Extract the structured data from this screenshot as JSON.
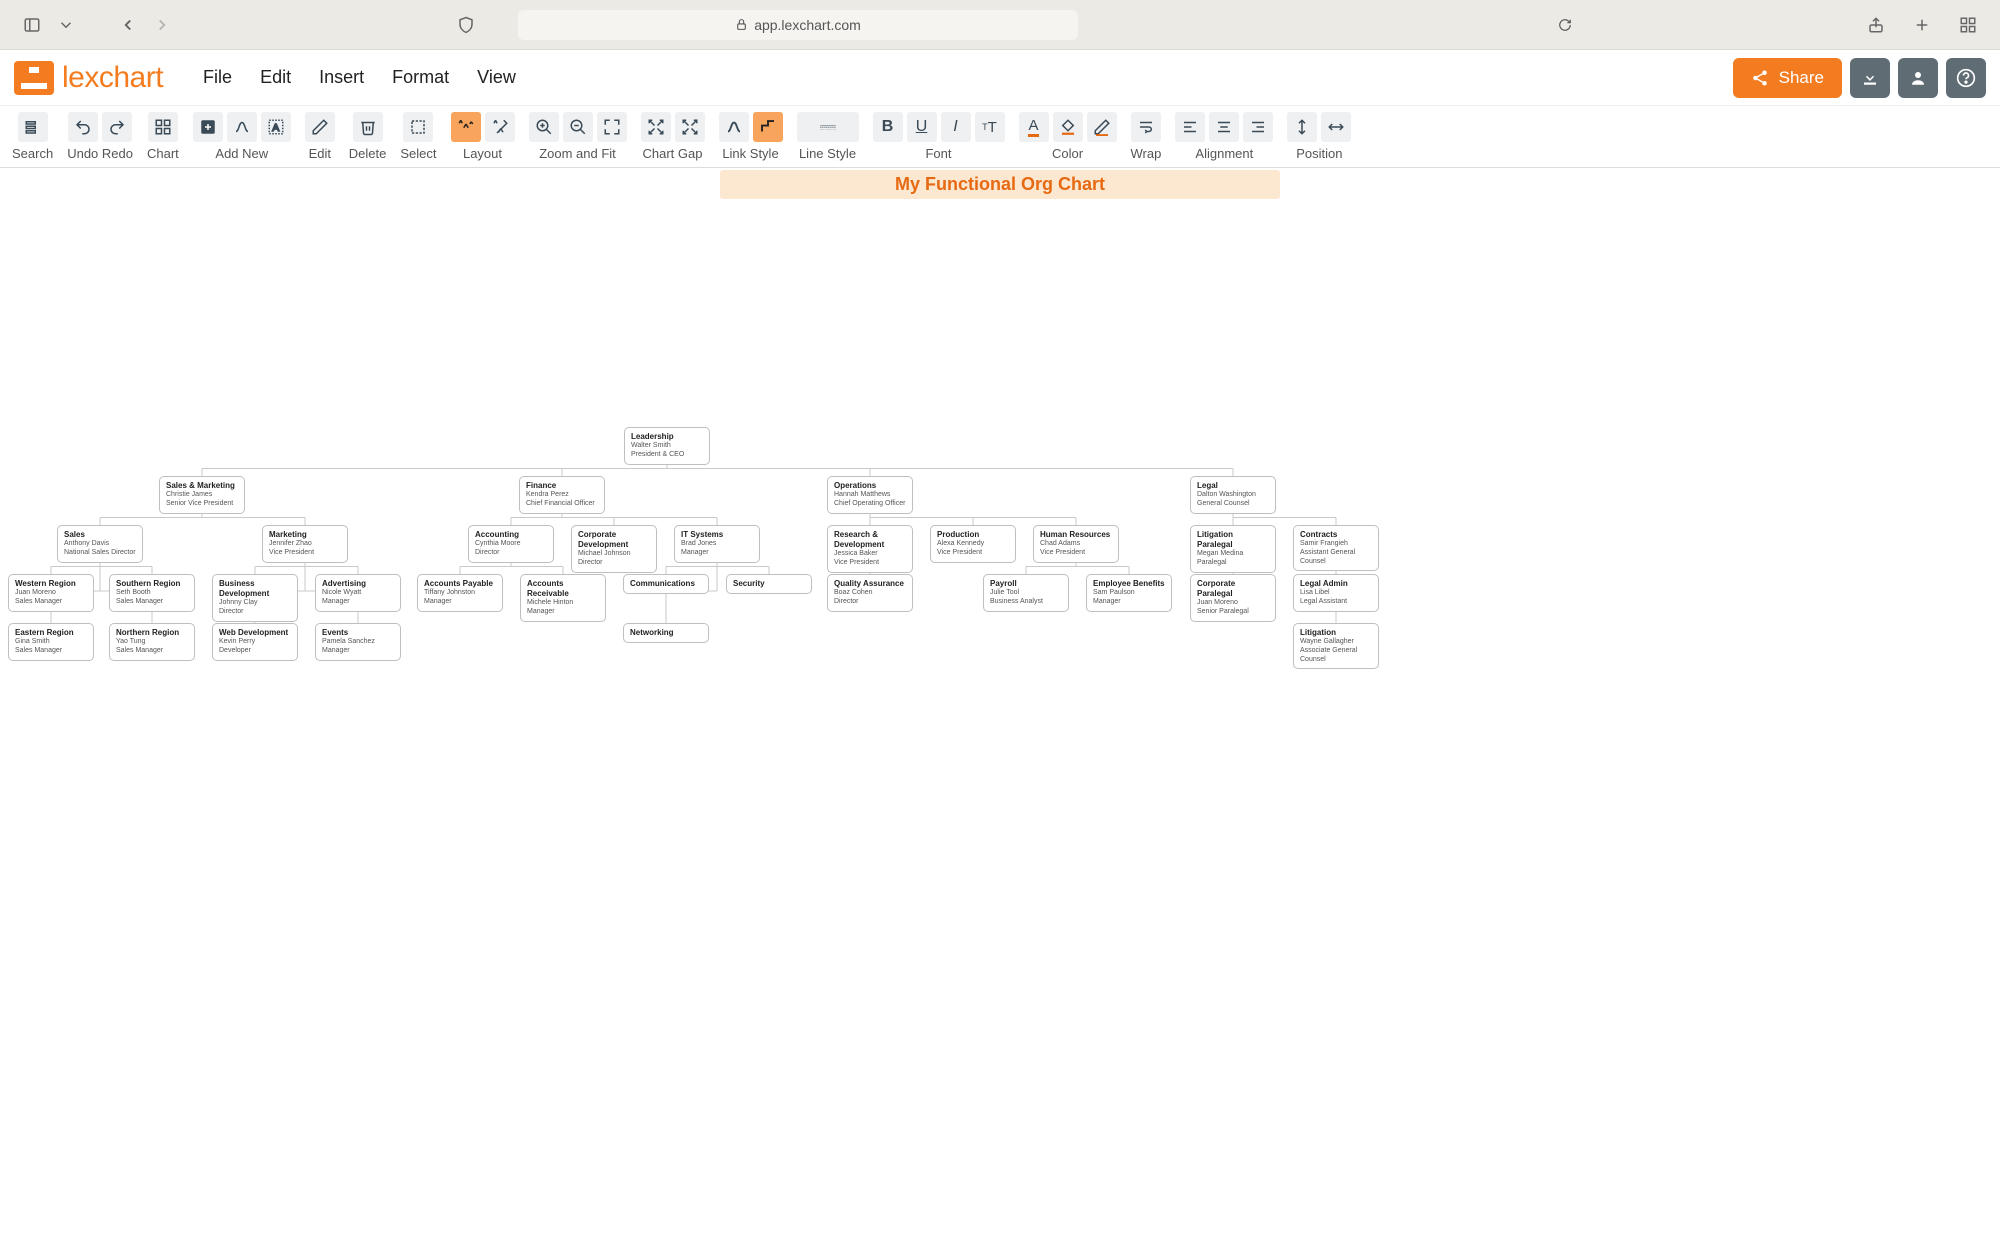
{
  "browser": {
    "url": "app.lexchart.com"
  },
  "app": {
    "menus": [
      "File",
      "Edit",
      "Insert",
      "Format",
      "View"
    ],
    "share_label": "Share"
  },
  "toolbar_labels": {
    "search": "Search",
    "undo_redo": "Undo Redo",
    "chart": "Chart",
    "add_new": "Add New",
    "edit": "Edit",
    "delete": "Delete",
    "select": "Select",
    "layout": "Layout",
    "zoom_fit": "Zoom and Fit",
    "chart_gap": "Chart Gap",
    "link_style": "Link Style",
    "line_style": "Line Style",
    "font": "Font",
    "color": "Color",
    "wrap": "Wrap",
    "alignment": "Alignment",
    "position": "Position"
  },
  "document": {
    "title": "My Functional Org Chart"
  },
  "chart_data": {
    "type": "tree",
    "root": {
      "title": "Leadership",
      "name": "Walter Smith",
      "role": "President & CEO",
      "children": [
        {
          "title": "Sales & Marketing",
          "name": "Christie James",
          "role": "Senior Vice President",
          "children": [
            {
              "title": "Sales",
              "name": "Anthony Davis",
              "role": "National Sales Director",
              "children": [
                {
                  "title": "Western Region",
                  "name": "Juan Moreno",
                  "role": "Sales Manager"
                },
                {
                  "title": "Southern Region",
                  "name": "Seth Booth",
                  "role": "Sales Manager"
                },
                {
                  "title": "Eastern Region",
                  "name": "Gina Smith",
                  "role": "Sales Manager"
                },
                {
                  "title": "Northern Region",
                  "name": "Yao Tung",
                  "role": "Sales Manager"
                }
              ]
            },
            {
              "title": "Marketing",
              "name": "Jennifer Zhao",
              "role": "Vice President",
              "children": [
                {
                  "title": "Business Development",
                  "name": "Johnny Clay",
                  "role": "Director"
                },
                {
                  "title": "Advertising",
                  "name": "Nicole Wyatt",
                  "role": "Manager"
                },
                {
                  "title": "Web Development",
                  "name": "Kevin Perry",
                  "role": "Developer"
                },
                {
                  "title": "Events",
                  "name": "Pamela Sanchez",
                  "role": "Manager"
                }
              ]
            }
          ]
        },
        {
          "title": "Finance",
          "name": "Kendra Perez",
          "role": "Chief Financial Officer",
          "children": [
            {
              "title": "Accounting",
              "name": "Cynthia Moore",
              "role": "Director",
              "children": [
                {
                  "title": "Accounts Payable",
                  "name": "Tiffany Johnston",
                  "role": "Manager"
                },
                {
                  "title": "Accounts Receivable",
                  "name": "Michele Hinton",
                  "role": "Manager"
                }
              ]
            },
            {
              "title": "Corporate Development",
              "name": "Michael Johnson",
              "role": "Director"
            },
            {
              "title": "IT Systems",
              "name": "Brad Jones",
              "role": "Manager",
              "children": [
                {
                  "title": "Communications"
                },
                {
                  "title": "Security"
                },
                {
                  "title": "Networking"
                }
              ]
            }
          ]
        },
        {
          "title": "Operations",
          "name": "Hannah Matthews",
          "role": "Chief Operating Officer",
          "children": [
            {
              "title": "Research & Development",
              "name": "Jessica Baker",
              "role": "Vice President",
              "children": [
                {
                  "title": "Quality Assurance",
                  "name": "Boaz Cohen",
                  "role": "Director"
                }
              ]
            },
            {
              "title": "Production",
              "name": "Alexa Kennedy",
              "role": "Vice President"
            },
            {
              "title": "Human Resources",
              "name": "Chad Adams",
              "role": "Vice President",
              "children": [
                {
                  "title": "Payroll",
                  "name": "Julie Tool",
                  "role": "Business Analyst"
                },
                {
                  "title": "Employee Benefits",
                  "name": "Sam Paulson",
                  "role": "Manager"
                }
              ]
            }
          ]
        },
        {
          "title": "Legal",
          "name": "Dalton Washington",
          "role": "General Counsel",
          "children": [
            {
              "title": "Litigation Paralegal",
              "name": "Megan Medina",
              "role": "Paralegal"
            },
            {
              "title": "Corporate Paralegal",
              "name": "Juan Moreno",
              "role": "Senior Paralegal"
            },
            {
              "title": "Contracts",
              "name": "Samir Frangieh",
              "role": "Assistant General Counsel",
              "children": [
                {
                  "title": "Legal Admin",
                  "name": "Lisa Libel",
                  "role": "Legal Assistant"
                },
                {
                  "title": "Litigation",
                  "name": "Wayne Gallagher",
                  "role": "Associate General Counsel"
                }
              ]
            }
          ]
        }
      ]
    }
  }
}
